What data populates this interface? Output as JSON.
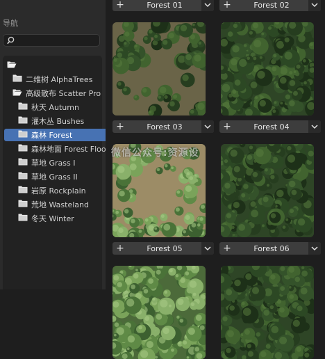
{
  "navigation": {
    "title": "导航",
    "search": {
      "placeholder": "",
      "value": ""
    },
    "tree": [
      {
        "label": "",
        "indent": 0,
        "open": true,
        "selected": false
      },
      {
        "label": "二维树 AlphaTrees",
        "indent": 1,
        "open": false,
        "selected": false
      },
      {
        "label": "高级散布 Scatter Pro",
        "indent": 1,
        "open": true,
        "selected": false
      },
      {
        "label": "秋天 Autumn",
        "indent": 2,
        "open": false,
        "selected": false
      },
      {
        "label": "灌木丛 Bushes",
        "indent": 2,
        "open": false,
        "selected": false
      },
      {
        "label": "森林 Forest",
        "indent": 2,
        "open": false,
        "selected": true
      },
      {
        "label": "森林地面 Forest Floor",
        "indent": 2,
        "open": false,
        "selected": false
      },
      {
        "label": "草地 Grass I",
        "indent": 2,
        "open": false,
        "selected": false
      },
      {
        "label": "草地 Grass II",
        "indent": 2,
        "open": false,
        "selected": false
      },
      {
        "label": "岩原 Rockplain",
        "indent": 2,
        "open": false,
        "selected": false
      },
      {
        "label": "荒地 Wasteland",
        "indent": 2,
        "open": false,
        "selected": false
      },
      {
        "label": "冬天 Winter",
        "indent": 2,
        "open": false,
        "selected": false
      }
    ]
  },
  "assets": [
    {
      "name": "Forest 01",
      "style": "top"
    },
    {
      "name": "Forest 02",
      "style": "top"
    },
    {
      "name": "Forest 03",
      "style": "patchy"
    },
    {
      "name": "Forest 04",
      "style": "dense-patchy"
    },
    {
      "name": "Forest 05",
      "style": "patchy-light"
    },
    {
      "name": "Forest 06",
      "style": "dense"
    },
    {
      "name": "",
      "style": "dense-light"
    },
    {
      "name": "",
      "style": "dense"
    }
  ],
  "icons": {
    "add": "plus-icon",
    "dropdown": "chevron-down-icon",
    "search": "search-icon",
    "folder": "folder-icon"
  },
  "watermark": "微信公众号:资源设",
  "colors": {
    "selection": "#4772b3",
    "panel": "#2b2b2b",
    "background": "#1e1e1e"
  }
}
